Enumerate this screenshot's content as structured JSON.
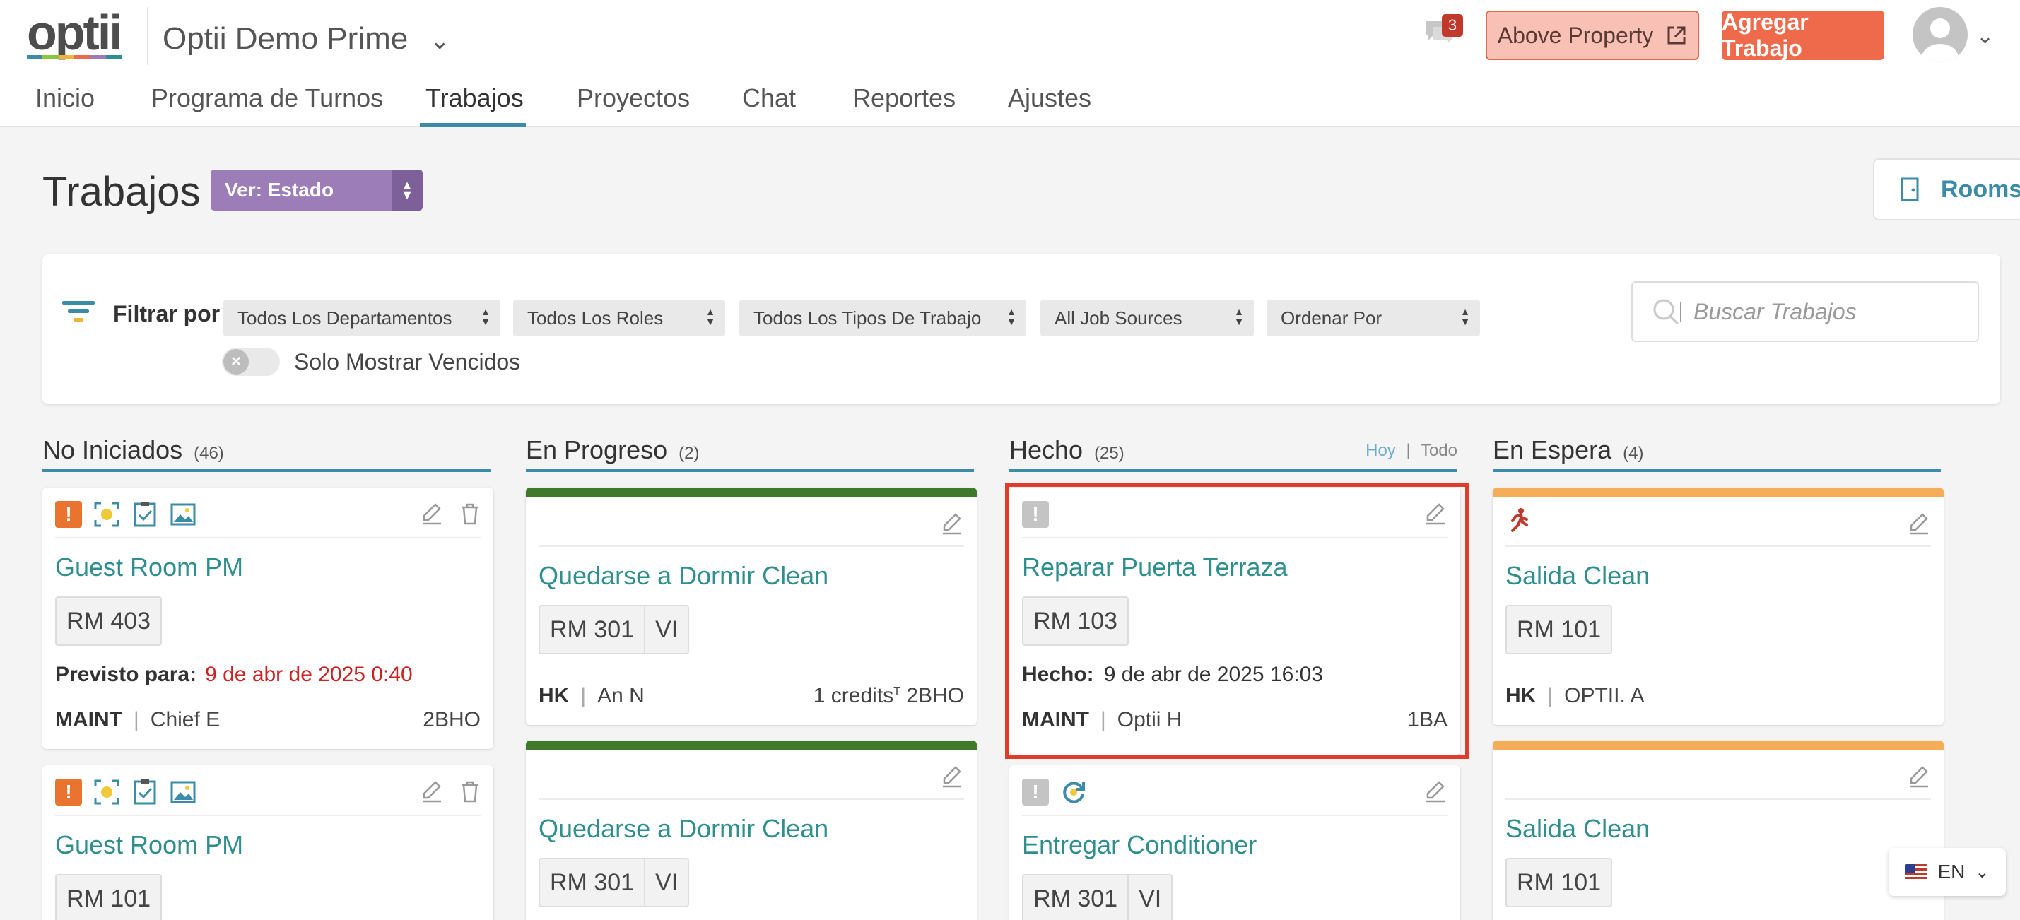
{
  "app": {
    "logo": "optii",
    "logo_colors": [
      "#3b8ba9",
      "#8cc63f",
      "#f0b33a",
      "#ee6a4a",
      "#9c7db8",
      "#2f8f8f"
    ],
    "property": "Optii Demo Prime",
    "chat_badge": "3",
    "above_property": "Above Property",
    "add_job": "Agregar Trabajo"
  },
  "nav": [
    "Inicio",
    "Programa de Turnos",
    "Trabajos",
    "Proyectos",
    "Chat",
    "Reportes",
    "Ajustes"
  ],
  "page": {
    "title": "Trabajos",
    "view_select": "Ver: Estado",
    "rooms_button": "Rooms"
  },
  "filters": {
    "label": "Filtrar por",
    "departments": "Todos Los Departamentos",
    "roles": "Todos Los Roles",
    "job_types": "Todos Los Tipos De Trabajo",
    "sources": "All Job Sources",
    "order": "Ordenar Por",
    "overdue_toggle": "Solo Mostrar Vencidos",
    "search_placeholder": "Buscar Trabajos"
  },
  "columns": {
    "not_started": {
      "title": "No Iniciados",
      "count": "(46)"
    },
    "in_progress": {
      "title": "En Progreso",
      "count": "(2)"
    },
    "done": {
      "title": "Hecho",
      "count": "(25)",
      "link_today": "Hoy",
      "link_sep": "|",
      "link_all": "Todo"
    },
    "on_hold": {
      "title": "En Espera",
      "count": "(4)"
    }
  },
  "cards": {
    "ns1": {
      "title": "Guest Room PM",
      "room": "RM 403",
      "due_label": "Previsto para:",
      "due_value": "9 de abr de 2025 0:40",
      "dept": "MAINT",
      "person": "Chief E",
      "code": "2BHO"
    },
    "ns2": {
      "title": "Guest Room PM",
      "room": "RM 101"
    },
    "ip1": {
      "title": "Quedarse a Dormir Clean",
      "room": "RM 301",
      "room_tag": "VI",
      "dept": "HK",
      "person": "An N",
      "credits": "1 credits",
      "credits_sup": "T",
      "code": "2BHO"
    },
    "ip2": {
      "title": "Quedarse a Dormir Clean",
      "room": "RM 301",
      "room_tag": "VI"
    },
    "d1": {
      "title": "Reparar Puerta Terraza",
      "room": "RM 103",
      "done_label": "Hecho:",
      "done_value": "9 de abr de 2025 16:03",
      "dept": "MAINT",
      "person": "Optii H",
      "code": "1BA"
    },
    "d2": {
      "title": "Entregar Conditioner",
      "room": "RM 301",
      "room_tag": "VI"
    },
    "oh1": {
      "title": "Salida Clean",
      "room": "RM 101",
      "dept": "HK",
      "person": "OPTII. A"
    },
    "oh2": {
      "title": "Salida Clean",
      "room": "RM 101"
    }
  },
  "colors": {
    "accent": "#3b8ba9",
    "in_progress_bar": "#3f7a2a",
    "on_hold_bar": "#f5ad57",
    "overdue": "#cc2222",
    "priority_orange": "#e8742f",
    "highlight": "#e03c2c"
  },
  "language": "EN",
  "icons": [
    "chat-icon",
    "external-link-icon",
    "user-avatar-icon",
    "door-icon",
    "filter-icon",
    "search-icon",
    "pencil-icon",
    "trash-icon",
    "exclamation-icon",
    "scan-icon",
    "checklist-icon",
    "image-icon",
    "running-person-icon",
    "refresh-icon",
    "flag-us-icon"
  ]
}
